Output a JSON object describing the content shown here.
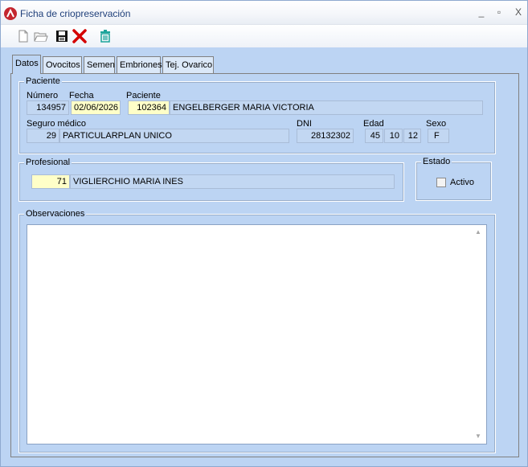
{
  "window": {
    "title": "Ficha de criopreservación",
    "minimize": "_",
    "maximize": "▫",
    "close": "X"
  },
  "tabs": [
    "Datos",
    "Ovocitos",
    "Semen",
    "Embriones",
    "Tej. Ovarico"
  ],
  "paciente": {
    "group_label": "Paciente",
    "numero_label": "Número",
    "numero": "134957",
    "fecha_label": "Fecha",
    "fecha": "02/06/2026",
    "paciente_label": "Paciente",
    "paciente_id": "102364",
    "paciente_nombre": "ENGELBERGER MARIA VICTORIA",
    "seguro_label": "Seguro médico",
    "seguro_id": "29",
    "seguro_nombre": "PARTICULARPLAN UNICO",
    "dni_label": "DNI",
    "dni": "28132302",
    "edad_label": "Edad",
    "edad_anios": "45",
    "edad_meses": "10",
    "edad_dias": "12",
    "sexo_label": "Sexo",
    "sexo": "F"
  },
  "profesional": {
    "group_label": "Profesional",
    "id": "71",
    "nombre": "VIGLIERCHIO MARIA INES"
  },
  "estado": {
    "group_label": "Estado",
    "activo_label": "Activo",
    "activo_checked": false
  },
  "observaciones": {
    "group_label": "Observaciones",
    "text": ""
  },
  "colors": {
    "window_bg": "#bcd4f3",
    "input_highlight": "#ffffc8",
    "delete_red": "#d40000",
    "trash_teal": "#1aa39a"
  }
}
